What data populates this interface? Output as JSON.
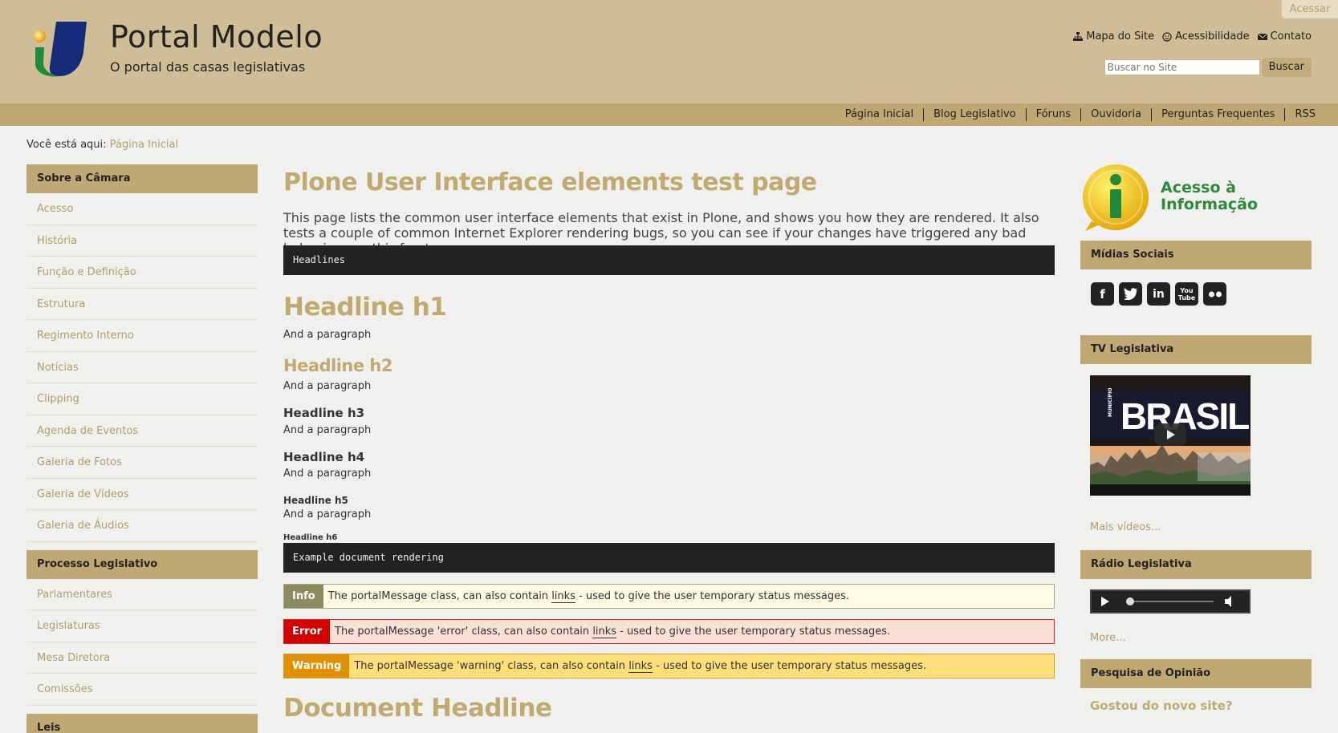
{
  "header": {
    "login_label": "Acessar",
    "site_title": "Portal Modelo",
    "site_subtitle": "O portal das casas legislativas",
    "top_links": [
      {
        "icon": "sitemap-icon",
        "label": "Mapa do Site"
      },
      {
        "icon": "accessibility-icon",
        "label": "Acessibilidade"
      },
      {
        "icon": "envelope-icon",
        "label": "Contato"
      }
    ],
    "search": {
      "placeholder": "Buscar no Site",
      "button_label": "Buscar"
    }
  },
  "navbar": {
    "items": [
      "Página Inicial",
      "Blog Legislativo",
      "Fóruns",
      "Ouvidoria",
      "Perguntas Frequentes",
      "RSS"
    ]
  },
  "breadcrumb": {
    "prefix": "Você está aqui:",
    "current": "Página Inicial"
  },
  "left": {
    "sections": [
      {
        "title": "Sobre a Câmara",
        "items": [
          "Acesso",
          "História",
          "Função e Definição",
          "Estrutura",
          "Regimento Interno",
          "Notícias",
          "Clipping",
          "Agenda de Eventos",
          "Galeria de Fotos",
          "Galeria de Vídeos",
          "Galeria de Áudios"
        ]
      },
      {
        "title": "Processo Legislativo",
        "items": [
          "Parlamentares",
          "Legislaturas",
          "Mesa Diretora",
          "Comissões"
        ]
      },
      {
        "title": "Leis",
        "items": []
      }
    ]
  },
  "main": {
    "title": "Plone User Interface elements test page",
    "description": "This page lists the common user interface elements that exist in Plone, and shows you how they are rendered. It also tests a couple of common Internet Explorer rendering bugs, so you can see if your changes have triggered any bad behaviour on this front.",
    "code1": "Headlines",
    "h1": "Headline h1",
    "h2": "Headline h2",
    "h3": "Headline h3",
    "h4": "Headline h4",
    "h5": "Headline h5",
    "h6": "Headline h6",
    "paragraph": "And a paragraph",
    "code2": "Example document rendering",
    "messages": {
      "info": {
        "tag": "Info",
        "before": "The portalMessage class, can also contain",
        "link": "links",
        "after": "- used to give the user temporary status messages.",
        "color": "#8a8b5e"
      },
      "error": {
        "tag": "Error",
        "before": "The portalMessage 'error' class, can also contain",
        "link": "links",
        "after": "- used to give the user temporary status messages.",
        "color": "#d50000"
      },
      "warning": {
        "tag": "Warning",
        "before": "The portalMessage 'warning' class, can also contain",
        "link": "links",
        "after": "- used to give the user temporary status messages.",
        "color": "#e09000"
      }
    },
    "document_headline": "Document Headline"
  },
  "right": {
    "acesso_line1": "Acesso à",
    "acesso_line2": "Informação",
    "social_title": "Mídias Sociais",
    "social_icons": [
      "facebook-icon",
      "twitter-icon",
      "linkedin-icon",
      "youtube-icon",
      "flickr-icon"
    ],
    "tv_title": "TV Legislativa",
    "video_caption": "BRASIL",
    "video_small": "MUNICÍPIO",
    "more_videos": "Mais vídeos...",
    "radio_title": "Rádio Legislativa",
    "more_radio": "More...",
    "poll_title": "Pesquisa de Opinião",
    "poll_question": "Gostou do novo site?"
  },
  "colors": {
    "header_bg": "#d0bd97",
    "nav_bg": "#bfa874",
    "accent": "#c2a970",
    "link": "#b59c68"
  }
}
